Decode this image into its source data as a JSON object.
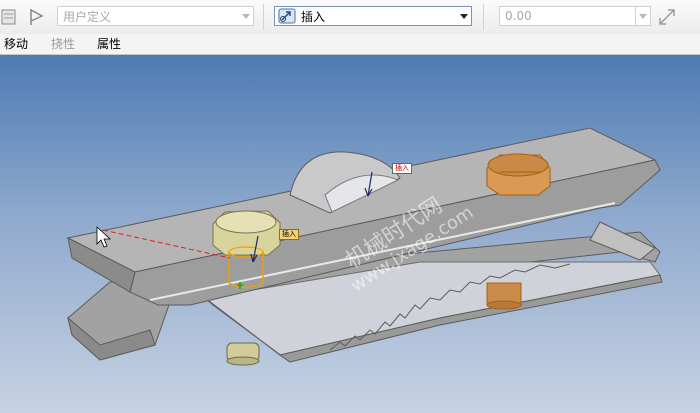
{
  "toolbar": {
    "constraint_type_value": "用户定义",
    "constraint_value": "插入",
    "offset_value": "0.00"
  },
  "menu": {
    "items": [
      {
        "label": "移动",
        "enabled": true
      },
      {
        "label": "挠性",
        "enabled": false
      },
      {
        "label": "属性",
        "enabled": true
      }
    ]
  },
  "viewport": {
    "tag_top": "插入",
    "tag_bottom": "插入",
    "watermark_cn": "机械时代网",
    "watermark_url": "www.jxage.com"
  },
  "colors": {
    "viewport_top": "#4d7bb3",
    "viewport_bottom": "#c6d2e2",
    "part_gray": "#a7a7a7",
    "bolt_orange": "#d99a55",
    "bolt_khaki": "#d8d29c",
    "selection_orange": "#f0a000"
  },
  "icons": [
    "placement-icon",
    "flag-icon",
    "insert-constraint-icon",
    "swap-icon",
    "mouse-cursor-icon"
  ]
}
